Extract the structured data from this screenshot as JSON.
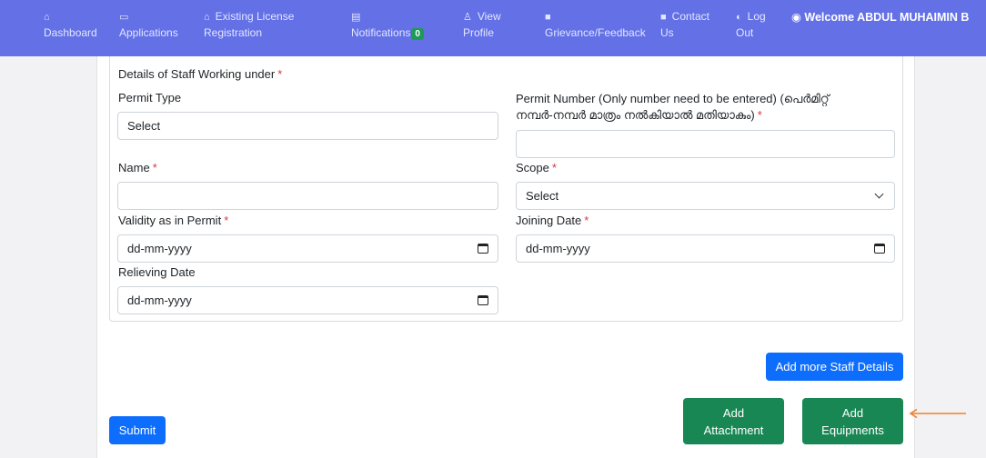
{
  "nav": {
    "items": [
      {
        "icon": "⌂",
        "line1": "",
        "line2": "Dashboard"
      },
      {
        "icon": "▭",
        "line1": "",
        "line2": "Applications"
      },
      {
        "icon": "⌂",
        "line1": "Existing License",
        "line2": "Registration"
      },
      {
        "icon": "▤",
        "line1": "",
        "line2": "Notifications"
      },
      {
        "icon": "♙",
        "line1": "View",
        "line2": "Profile"
      },
      {
        "icon": "■",
        "line1": "",
        "line2": "Grievance/Feedback"
      },
      {
        "icon": "■",
        "line1": "Contact",
        "line2": "Us"
      },
      {
        "icon": "◐",
        "line1": "Log",
        "line2": "Out"
      }
    ],
    "notification_count": "0",
    "welcome": "Welcome ABDUL MUHAIMIN B"
  },
  "form": {
    "section_title": "Details of Staff Working under",
    "permit_type": {
      "label": "Permit Type",
      "value": "Select"
    },
    "permit_number": {
      "label_line1": "Permit Number (Only number need to be entered) (പെർമിറ്റ്",
      "label_line2": "നമ്പർ-നമ്പർ മാത്രം നൽകിയാൽ മതിയാകും)",
      "value": ""
    },
    "name": {
      "label": "Name",
      "value": ""
    },
    "scope": {
      "label": "Scope",
      "value": "Select"
    },
    "validity": {
      "label": "Validity as in Permit",
      "value": "dd-mm-yyyy"
    },
    "joining_date": {
      "label": "Joining Date",
      "value": "dd-mm-yyyy"
    },
    "relieving_date": {
      "label": "Relieving Date",
      "value": "dd-mm-yyyy"
    },
    "required_mark": "*"
  },
  "buttons": {
    "add_more": "Add more Staff Details",
    "submit": "Submit",
    "add_attachment_1": "Add",
    "add_attachment_2": "Attachment",
    "add_equipments_1": "Add",
    "add_equipments_2": "Equipments"
  },
  "colors": {
    "navbar": "#6370e6",
    "primary": "#0d6efd",
    "success": "#198754",
    "arrow": "#f07f2a"
  }
}
